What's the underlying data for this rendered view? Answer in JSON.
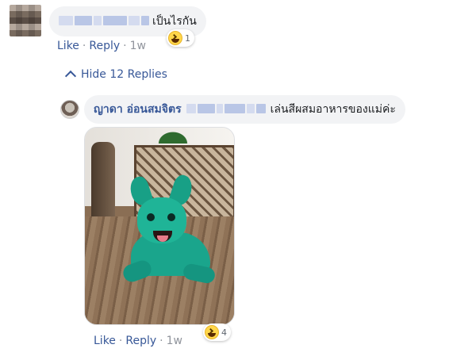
{
  "comment1": {
    "text": "เป็นไรกัน",
    "reaction_icon": "haha-icon",
    "reaction_count": "1",
    "actions": {
      "like": "Like",
      "reply": "Reply",
      "separator": "·",
      "time": "1w"
    }
  },
  "replies_toggle": {
    "label": "Hide 12 Replies"
  },
  "reply1": {
    "author": "ญาดา อ่อนสมจิตร",
    "text": "เล่นสีผสมอาหารของแม่ค่ะ",
    "reaction_icon": "haha-icon",
    "reaction_count": "4",
    "actions": {
      "like": "Like",
      "reply": "Reply",
      "separator": "·",
      "time": "1w"
    }
  },
  "colors": {
    "link": "#385898",
    "bubble": "#f2f3f5",
    "meta": "#90949c"
  }
}
